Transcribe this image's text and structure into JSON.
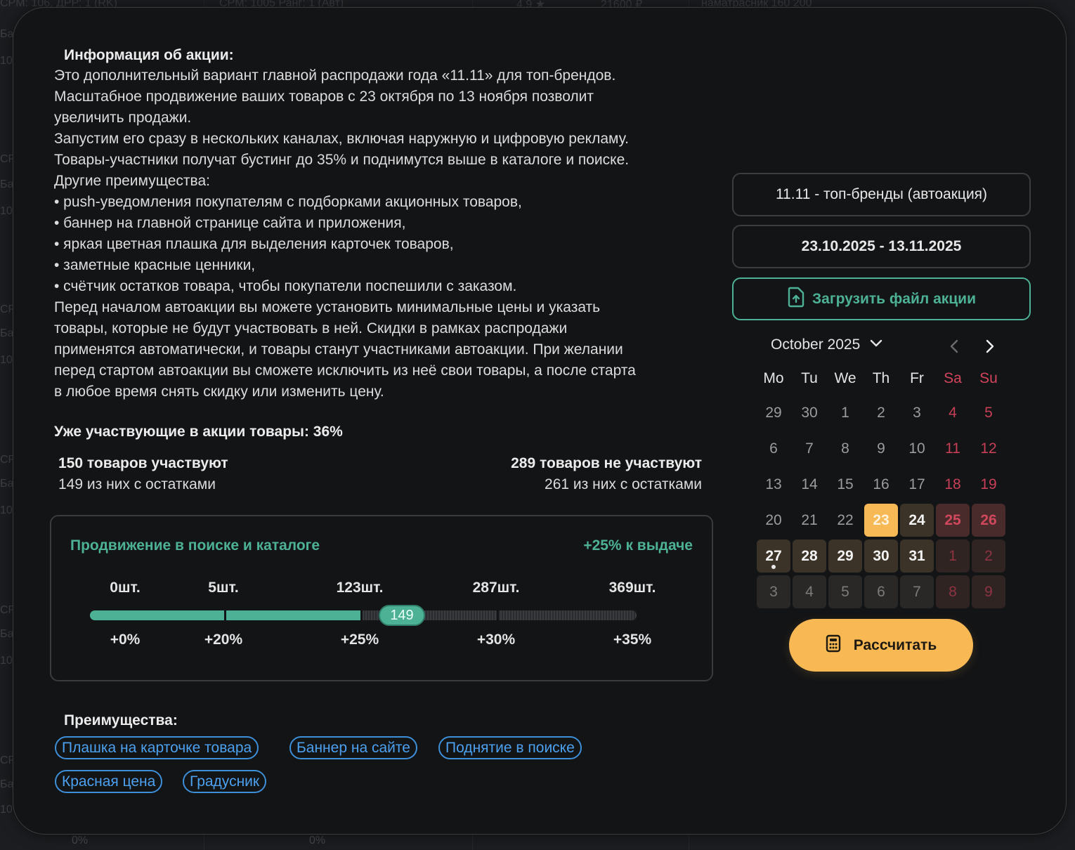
{
  "info": {
    "title": "Информация об акции:",
    "lines": [
      "Это дополнительный вариант главной распродажи года «11.11» для топ-брендов.",
      "Масштабное продвижение ваших товаров с 23 октября по 13 ноября позволит",
      "увеличить продажи.",
      "Запустим его сразу в нескольких каналах, включая наружную и цифровую рекламу.",
      "Товары-участники получат бустинг до 35% и поднимутся выше в каталоге и поиске.",
      "Другие преимущества:",
      "• push-уведомления покупателям с подборками акционных товаров,",
      "• баннер на главной странице сайта и приложения,",
      "• яркая цветная плашка для выделения карточек товаров,",
      "• заметные красные ценники,",
      "• счётчик остатков товара, чтобы покупатели поспешили с заказом.",
      "Перед началом автоакции вы можете установить минимальные цены и указать",
      "товары, которые не будут участвовать в ней. Скидки в рамках распродажи",
      "применятся автоматически, и товары станут участниками автоакции. При желании",
      "перед стартом автоакции вы сможете исключить из неё свои товары, а после старта",
      "в любое время снять скидку или изменить цену."
    ]
  },
  "participation": {
    "title": "Уже участвующие в акции товары: 36%",
    "participating": "150 товаров участвуют",
    "participating_stock": "149 из них с остатками",
    "not_participating": "289 товаров не участвуют",
    "not_participating_stock": "261 из них с остатками"
  },
  "promotion": {
    "title": "Продвижение в поиске и каталоге",
    "bonus": "+25% к выдаче",
    "current_label": "149",
    "current_value": 149,
    "ticks": [
      {
        "count": "0шт.",
        "percent": "+0%"
      },
      {
        "count": "5шт.",
        "percent": "+20%"
      },
      {
        "count": "123шт.",
        "percent": "+25%"
      },
      {
        "count": "287шт.",
        "percent": "+30%"
      },
      {
        "count": "369шт.",
        "percent": "+35%"
      }
    ]
  },
  "advantages": {
    "title": "Преимущества:",
    "chips": [
      "Плашка на карточке товара",
      "Баннер на сайте",
      "Поднятие в поиске",
      "Красная цена",
      "Градусник"
    ]
  },
  "sidebar": {
    "promo_name": "11.11 - топ-бренды (автоакция)",
    "date_range": "23.10.2025 - 13.11.2025",
    "upload_label": "Загрузить файл акции",
    "calc_label": "Рассчитать"
  },
  "calendar": {
    "month_label": "October 2025",
    "weekdays": [
      "Mo",
      "Tu",
      "We",
      "Th",
      "Fr",
      "Sa",
      "Su"
    ],
    "weeks": [
      [
        "29",
        "30",
        "1",
        "2",
        "3",
        "4",
        "5"
      ],
      [
        "6",
        "7",
        "8",
        "9",
        "10",
        "11",
        "12"
      ],
      [
        "13",
        "14",
        "15",
        "16",
        "17",
        "18",
        "19"
      ],
      [
        "20",
        "21",
        "22",
        "23",
        "24",
        "25",
        "26"
      ],
      [
        "27",
        "28",
        "29",
        "30",
        "31",
        "1",
        "2"
      ],
      [
        "3",
        "4",
        "5",
        "6",
        "7",
        "8",
        "9"
      ]
    ],
    "range_start_day": "23",
    "today": "27"
  },
  "background": {
    "top_texts": [
      "CPM: 106, ДРР: 1 (RK)",
      "CPM: 1005 Ранг: 1 (Авт)",
      "4.9 ★",
      "21600 ₽",
      "наматрасник 160 200"
    ],
    "left_texts": [
      "Ба",
      "10",
      "CP",
      "Ба",
      "10",
      "CP",
      "Ба",
      "10",
      "CP",
      "Ба",
      "10",
      "CP",
      "Ба",
      "10",
      "CP",
      "Ба",
      "10"
    ],
    "bottom_texts": [
      "0%",
      "0%"
    ]
  },
  "colors": {
    "accent_green": "#4db195",
    "accent_yellow": "#f8b954",
    "chip_blue": "#4ca1ef",
    "weekend_red": "#d2445c"
  }
}
